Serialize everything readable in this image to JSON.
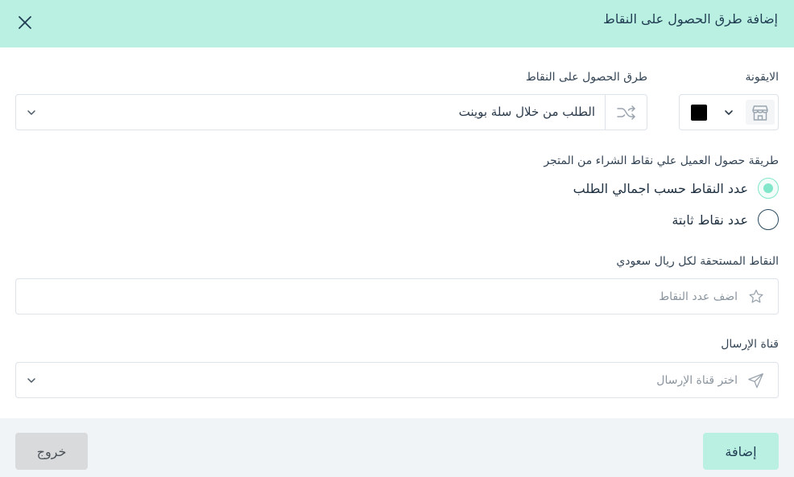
{
  "header": {
    "title": "إضافة طرق الحصول على النقاط",
    "close_icon": "close-icon"
  },
  "icon_field": {
    "label": "الايقونة",
    "selected_icon": "store-icon",
    "color": "#000000"
  },
  "method_field": {
    "label": "طرق الحصول على النقاط",
    "value": "الطلب من خلال سلة بوينت",
    "icon": "shuffle-icon"
  },
  "earning_method": {
    "label": "طريقة حصول العميل علي نقاط الشراء من المتجر",
    "options": [
      {
        "label": "عدد النقاط حسب اجمالي الطلب",
        "checked": true
      },
      {
        "label": "عدد نقاط ثابتة",
        "checked": false
      }
    ]
  },
  "points_field": {
    "label": "النقاط المستحقة لكل ريال سعودي",
    "placeholder": "اضف عدد النقاط",
    "icon": "star-icon"
  },
  "channel_field": {
    "label": "قناة الإرسال",
    "placeholder": "اختر قناة الإرسال",
    "icon": "send-icon"
  },
  "footer": {
    "add_label": "إضافة",
    "exit_label": "خروج"
  },
  "colors": {
    "accent": "#baf0e2",
    "radio_active": "#82e6cb",
    "footer_bg": "#f1f4f7",
    "exit_button": "#d8dadc"
  }
}
